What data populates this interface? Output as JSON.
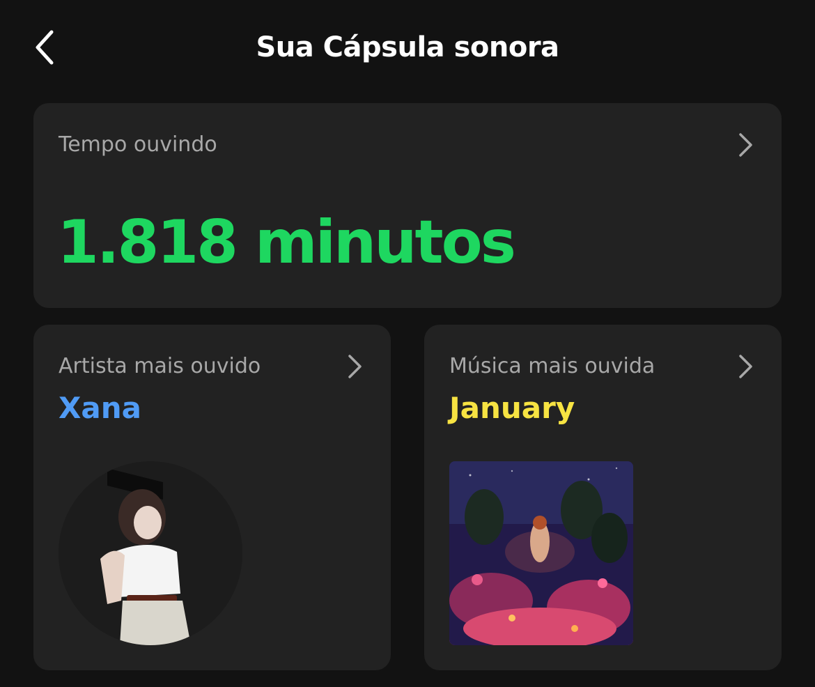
{
  "header": {
    "title": "Sua Cápsula sonora",
    "back_icon": "chevron-left-icon"
  },
  "listening_time": {
    "label": "Tempo ouvindo",
    "value": "1.818 minutos",
    "value_color": "#1ed760",
    "chevron_icon": "chevron-right-icon"
  },
  "top_artist": {
    "label": "Artista mais ouvido",
    "value": "Xana",
    "value_color": "#509bf5",
    "chevron_icon": "chevron-right-icon",
    "image": "artist-photo"
  },
  "top_song": {
    "label": "Música mais ouvida",
    "value": "January",
    "value_color": "#f7e342",
    "chevron_icon": "chevron-right-icon",
    "image": "album-cover"
  },
  "colors": {
    "background": "#121212",
    "card": "#222222",
    "label": "#a8a8a8",
    "title": "#ffffff"
  }
}
